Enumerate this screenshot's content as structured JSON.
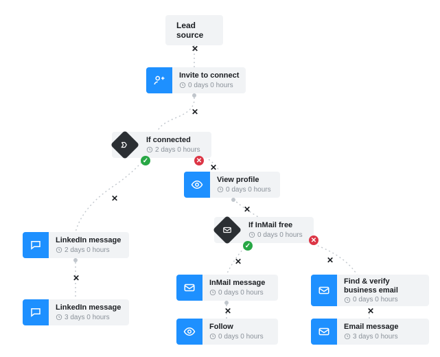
{
  "nodes": {
    "lead_source": {
      "label": "Lead source"
    },
    "invite": {
      "title": "Invite to connect",
      "delay": "0 days 0 hours"
    },
    "if_connected": {
      "title": "If connected",
      "delay": "2 days 0 hours"
    },
    "view_profile": {
      "title": "View profile",
      "delay": "0 days 0 hours"
    },
    "if_inmail": {
      "title": "If InMail free",
      "delay": "0 days 0 hours"
    },
    "li_msg_1": {
      "title": "LinkedIn message",
      "delay": "2 days 0 hours"
    },
    "li_msg_2": {
      "title": "LinkedIn message",
      "delay": "3 days 0 hours"
    },
    "inmail_msg": {
      "title": "InMail message",
      "delay": "0 days 0 hours"
    },
    "follow": {
      "title": "Follow",
      "delay": "0 days 0 hours"
    },
    "find_email": {
      "title": "Find & verify business email",
      "delay": "0 days 0 hours"
    },
    "email_msg": {
      "title": "Email message",
      "delay": "3 days 0 hours"
    }
  }
}
